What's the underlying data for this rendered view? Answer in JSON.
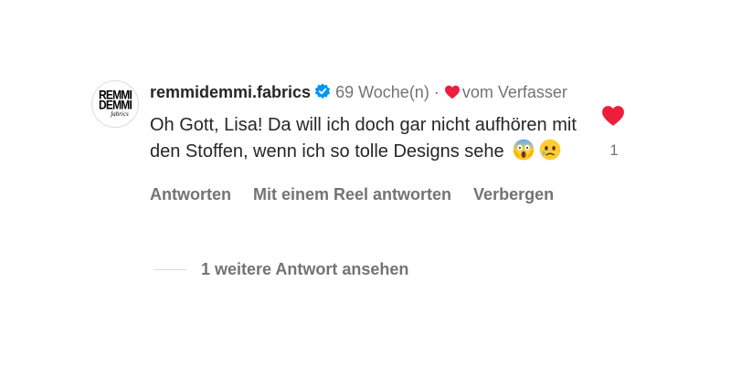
{
  "comment": {
    "avatar": {
      "logo_line1": "REMMI",
      "logo_line2": "DEMMI",
      "logo_line3": "fabrics"
    },
    "username": "remmidemmi.fabrics",
    "verified": true,
    "time_ago": "69 Woche(n)",
    "separator": "·",
    "liked_by_author_label": "vom Verfasser",
    "text": "Oh Gott, Lisa! Da will ich doch gar nicht aufhören mit den Stoffen, wenn ich so tolle Designs sehe",
    "emojis": [
      "face-screaming-in-fear",
      "face-holding-back-tears"
    ],
    "like_count": "1",
    "liked": true,
    "actions": {
      "reply": "Antworten",
      "reply_with_reel": "Mit einem Reel antworten",
      "hide": "Verbergen"
    },
    "view_more_replies": "1 weitere Antwort ansehen",
    "colors": {
      "like_red": "#ed1d3b",
      "verified_blue": "#0095f6",
      "secondary_text": "#737373",
      "primary_text": "#262626"
    }
  }
}
